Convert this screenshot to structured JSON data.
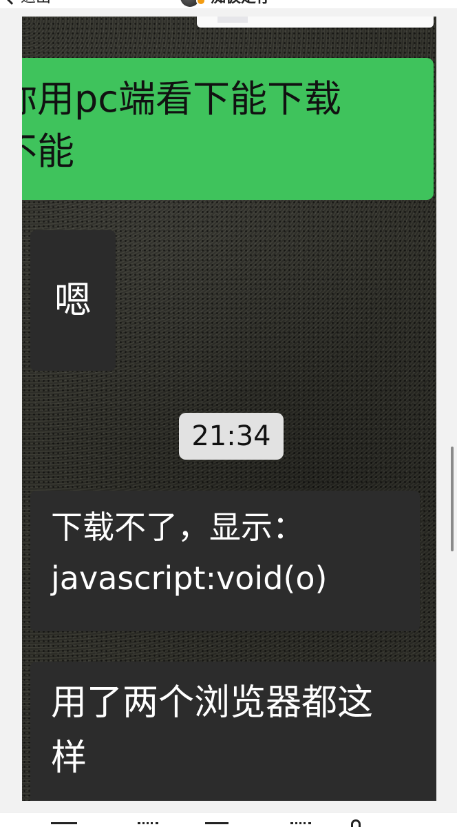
{
  "topbar": {
    "back_label": "退出",
    "user_name": "痴仮定存"
  },
  "chat": {
    "green_bubble": {
      "lines": [
        "你用pc端看下能下载",
        "不能"
      ]
    },
    "reply_short": "嗯",
    "timestamp": "21:34",
    "download_message": {
      "lines": [
        "下载不了，显示：",
        "javascript:void(o)"
      ]
    },
    "browser_message": {
      "lines": [
        "用了两个浏览器都这",
        "样"
      ]
    }
  },
  "colors": {
    "bubble_green": "#3fc35c",
    "bubble_dark": "#2c2c2c",
    "timestamp_bg": "#e2e2e2",
    "chat_bg": "#33332d"
  },
  "icons": {
    "back": "chevron-left-icon",
    "avatar_badge": "verified-badge-icon",
    "toolbar": [
      "forward-icon",
      "comment-icon",
      "like-icon",
      "collect-icon",
      "share-icon"
    ]
  }
}
